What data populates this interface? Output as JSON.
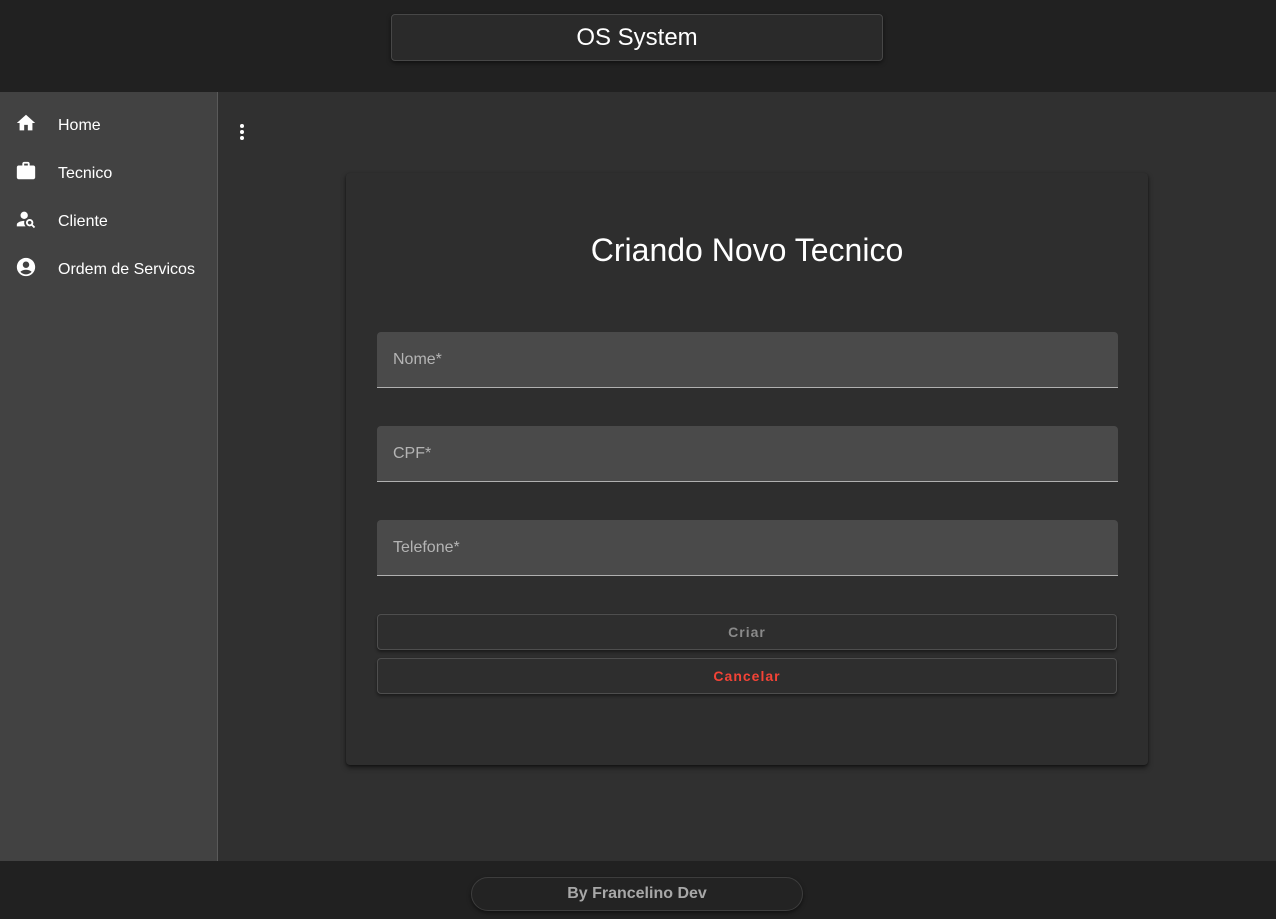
{
  "header": {
    "title": "OS System"
  },
  "sidebar": {
    "items": [
      {
        "label": "Home",
        "icon": "home-icon"
      },
      {
        "label": "Tecnico",
        "icon": "briefcase-icon"
      },
      {
        "label": "Cliente",
        "icon": "person-search-icon"
      },
      {
        "label": "Ordem de Servicos",
        "icon": "account-circle-icon"
      }
    ]
  },
  "main": {
    "menu_icon": "more-vert-icon",
    "card": {
      "title": "Criando Novo Tecnico",
      "fields": {
        "nome": {
          "placeholder": "Nome*",
          "value": ""
        },
        "cpf": {
          "placeholder": "CPF*",
          "value": ""
        },
        "telefone": {
          "placeholder": "Telefone*",
          "value": ""
        }
      },
      "buttons": {
        "criar": "Criar",
        "cancelar": "Cancelar"
      }
    }
  },
  "footer": {
    "text": "By Francelino Dev"
  },
  "colors": {
    "background": "#303030",
    "toolbar": "#212121",
    "sidebar": "#424242",
    "warn": "#f44336"
  }
}
